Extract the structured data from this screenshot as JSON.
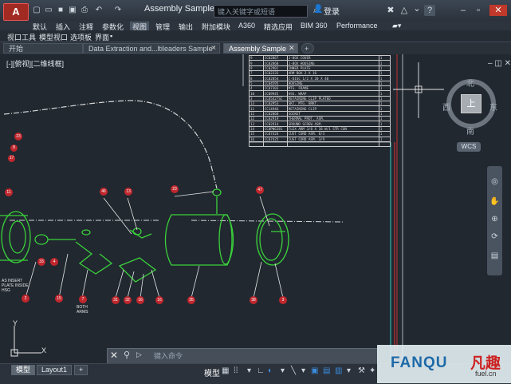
{
  "app": {
    "logo_letter": "A",
    "doc_title": "Assembly Sample...",
    "search_placeholder": "键入关键字或短语",
    "login_label": "登录",
    "help_label": "?",
    "quick_access_icons": [
      "new-icon",
      "open-icon",
      "save-icon",
      "saveas-icon",
      "print-icon",
      "undo-icon",
      "redo-icon"
    ]
  },
  "ribbon": {
    "tabs": [
      "默认",
      "插入",
      "注释",
      "参数化",
      "视图",
      "管理",
      "输出",
      "附加模块",
      "A360",
      "精选应用",
      "BIM 360",
      "Performance"
    ],
    "active_tab": "视图",
    "panels": [
      "视口工具",
      "模型视口",
      "选项板",
      "界面"
    ]
  },
  "doc_tabs": {
    "items": [
      {
        "label": "开始"
      },
      {
        "label": "Data Extraction and...ltileaders Sample*"
      },
      {
        "label": "Assembly Sample"
      },
      {
        "label": "+"
      }
    ],
    "active": 2
  },
  "viewport": {
    "label": "[-][俯视][二维线框]",
    "compass": {
      "n": "北",
      "s": "南",
      "e": "东",
      "w": "西",
      "face": "上"
    },
    "wcs": "WCS"
  },
  "parts_table": {
    "rows": [
      [
        "9",
        "CC02867",
        "J-BOX COVER",
        "1"
      ],
      [
        "9",
        "CC02868",
        "J-BOX HOUSING",
        "1"
      ],
      [
        "9",
        "CC02901",
        "INNER PLATE",
        "1"
      ],
      [
        "7",
        "CC02333",
        "ARM BOX 2 X 16",
        "1"
      ],
      [
        "8",
        "CC02854",
        "C-DISC 1/2 X 20 X 40",
        "1"
      ],
      [
        "5",
        "CC04595",
        "HOUSING",
        "1"
      ],
      [
        "4",
        "CC07303",
        "MTG. FRAME",
        "1"
      ],
      [
        "10",
        "CC09945",
        "HSG. WRAP",
        "1"
      ],
      [
        "3",
        "CC05427SC",
        "RETAINING CLIP PLATED",
        "1"
      ],
      [
        "13",
        "CC02953",
        "SKT. MTG. BRKT.",
        "1"
      ],
      [
        "11",
        "CC14946",
        "RETAINING CLIP",
        "1"
      ],
      [
        "12",
        "CC02068",
        "SOCKET",
        "1"
      ],
      [
        "12",
        "CC02919",
        "THERMAL PROT. ASM.",
        "1"
      ],
      [
        "13",
        "CC02914",
        "GROUND SCREW ASM.",
        "1"
      ],
      [
        "14",
        "CC0PN6381",
        "FLEX ARM 3/8 X 18 W/1 STR CON",
        "1"
      ],
      [
        "15",
        "CC07426",
        "CUST CORD ASM. 8/3",
        "1"
      ],
      [
        "16",
        "CC07425",
        "CUST CORD ASM. 3/9",
        "1"
      ],
      [
        "",
        "",
        "",
        ""
      ]
    ]
  },
  "drawing": {
    "balloons": [
      "23",
      "8",
      "17",
      "11",
      "46",
      "13",
      "23",
      "47",
      "33",
      "4",
      "2",
      "15",
      "31",
      "32",
      "16",
      "3",
      "16",
      "35",
      "38"
    ],
    "notes": [
      "AS INSERT",
      "PLATE INSIDE",
      "HSG",
      "BOTH",
      "ARMS"
    ],
    "ucs_x": "X",
    "ucs_y": "Y"
  },
  "command": {
    "prompt_symbol": "▷",
    "placeholder": "键入命令"
  },
  "status": {
    "layout_tabs": [
      "模型",
      "Layout1",
      "+"
    ],
    "active_layout": 0,
    "model_label": "模型"
  },
  "watermark": {
    "logo": "FANQU",
    "cn": "凡趣",
    "url": "fuel.cn"
  },
  "colors": {
    "canvas": "#212830",
    "geometry": "#3bd13b",
    "balloon": "#c0272d",
    "accent": "#1d6aa8"
  }
}
